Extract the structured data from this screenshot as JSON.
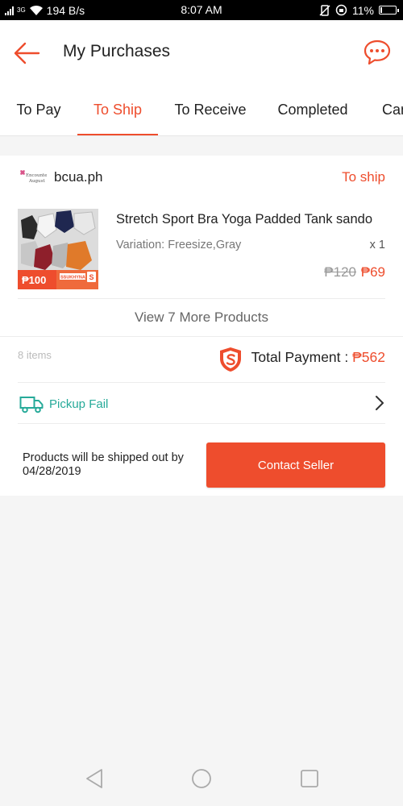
{
  "status_bar": {
    "network": "3G",
    "speed": "194 B/s",
    "time": "8:07 AM",
    "battery": "11%",
    "battery_level": 0.11
  },
  "header": {
    "title": "My Purchases"
  },
  "tabs": [
    {
      "label": "To Pay"
    },
    {
      "label": "To Ship"
    },
    {
      "label": "To Receive"
    },
    {
      "label": "Completed"
    },
    {
      "label": "Cancelled"
    }
  ],
  "active_tab": "To Ship",
  "order": {
    "shop_name": "bcua.ph",
    "shop_logo_text": "Encounter August",
    "status": "To ship",
    "product": {
      "name": "Stretch Sport Bra Yoga Padded Tank sando",
      "variation": "Variation: Freesize,Gray",
      "quantity": "x 1",
      "price_original": "₱120",
      "price_current": "₱69",
      "thumb_badge_price": "₱100",
      "thumb_badge_code": "SSUKHYNA"
    },
    "view_more": "View 7 More Products",
    "items_count": "8 items",
    "total_label": "Total Payment : ",
    "total_amount": "₱562",
    "shipping_status": "Pickup Fail",
    "ship_note": "Products will be shipped out by 04/28/2019",
    "contact_button": "Contact Seller"
  },
  "colors": {
    "accent": "#ee4d2d",
    "teal": "#26aa99",
    "background": "#f5f5f5"
  }
}
